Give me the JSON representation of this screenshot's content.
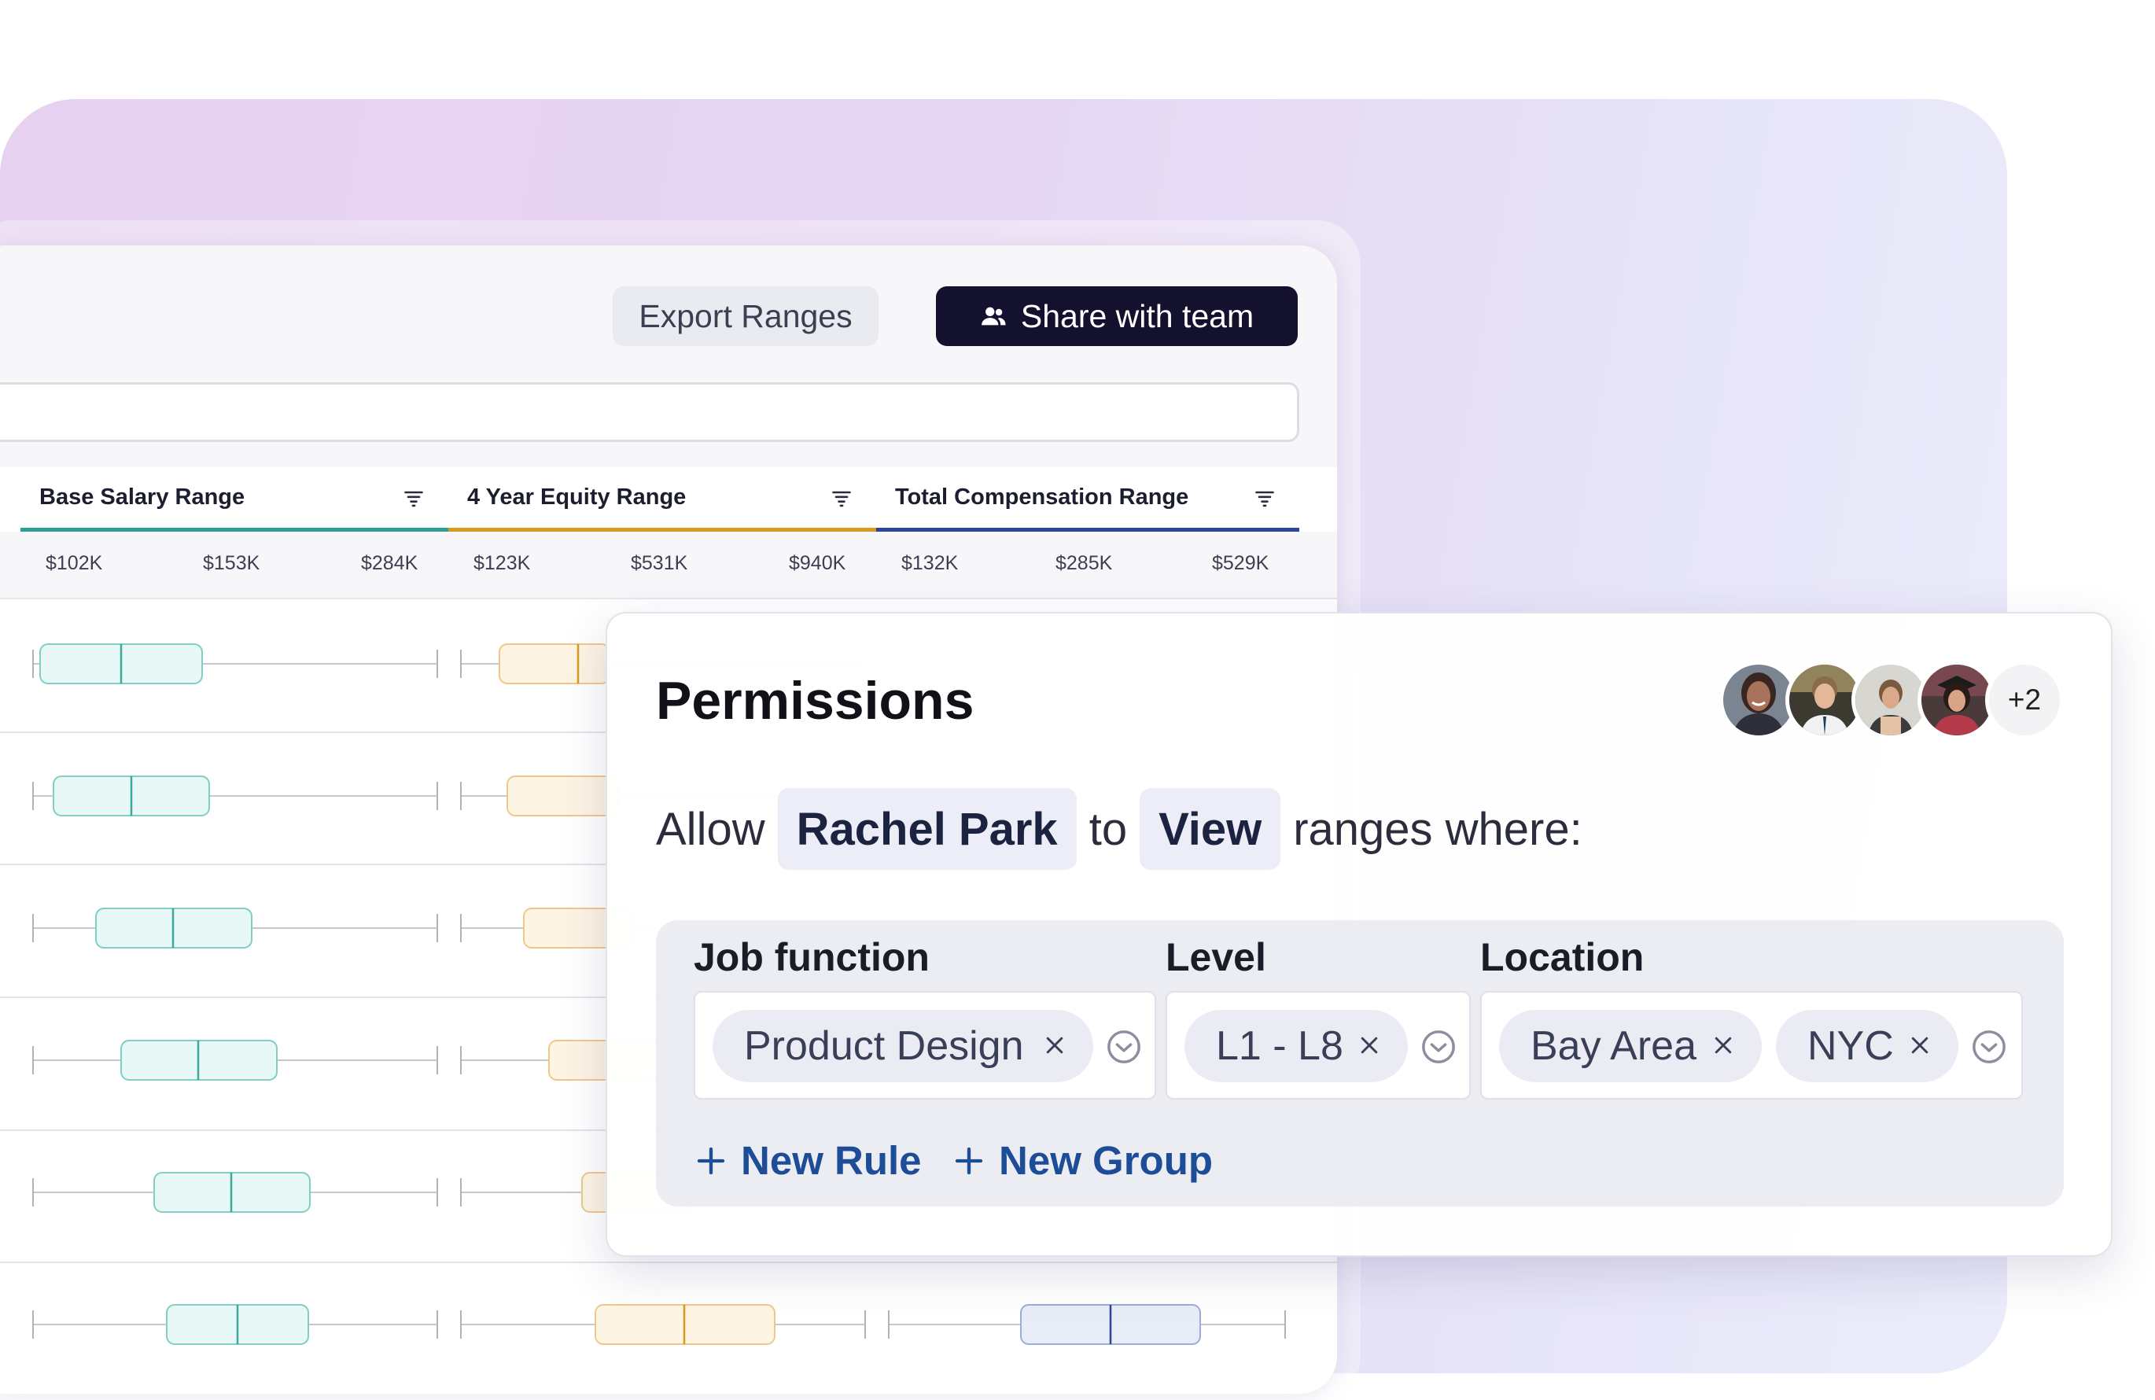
{
  "toolbar": {
    "export_label": "Export Ranges",
    "share_label": "Share with team"
  },
  "table": {
    "columns": [
      {
        "label": "Base Salary Range",
        "ticks": [
          "$102K",
          "$153K",
          "$284K"
        ],
        "color": "#2f9e94"
      },
      {
        "label": "4 Year Equity Range",
        "ticks": [
          "$123K",
          "$531K",
          "$940K"
        ],
        "color": "#d89a1c"
      },
      {
        "label": "Total Compensation Range",
        "ticks": [
          "$132K",
          "$285K",
          "$529K"
        ],
        "color": "#2d4596"
      }
    ]
  },
  "permissions": {
    "title": "Permissions",
    "avatars_more": "+2",
    "sentence": {
      "allow": "Allow",
      "person": "Rachel Park",
      "to": "to",
      "access": "View",
      "suffix": "ranges where:"
    },
    "filters": {
      "job_function": {
        "label": "Job function",
        "tags": [
          "Product Design"
        ]
      },
      "level": {
        "label": "Level",
        "tags": [
          "L1 - L8"
        ]
      },
      "location": {
        "label": "Location",
        "tags": [
          "Bay Area",
          "NYC"
        ]
      }
    },
    "new_rule_label": "New Rule",
    "new_group_label": "New Group"
  }
}
